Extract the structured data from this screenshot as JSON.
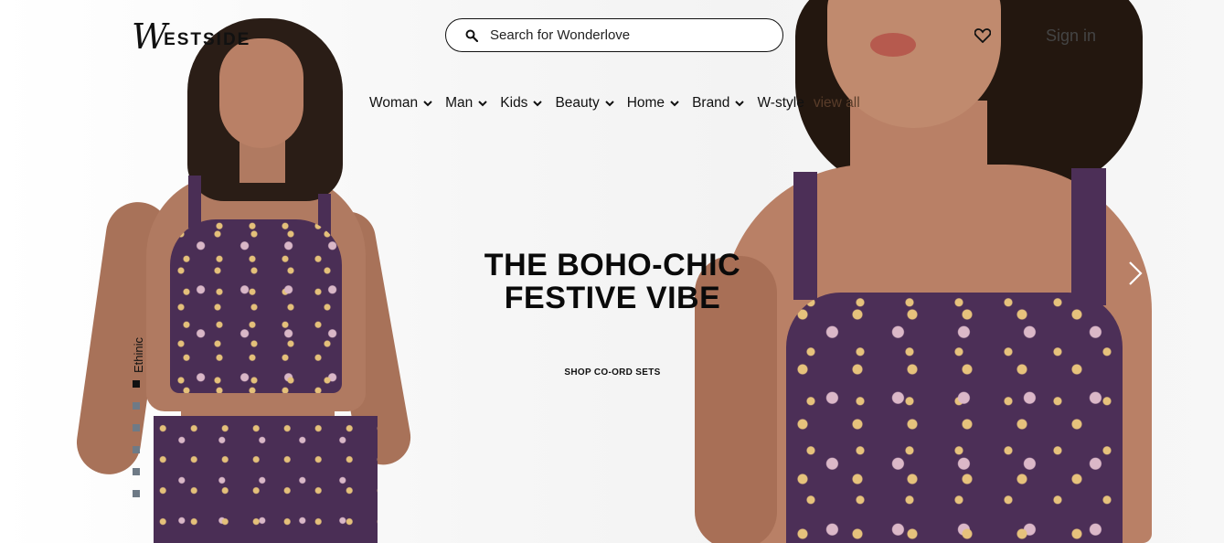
{
  "header": {
    "logo": {
      "initial": "W",
      "rest": "ESTSIDE"
    },
    "search": {
      "placeholder": "Search for Wonderlove",
      "value": ""
    },
    "wishlist_icon": "heart-icon",
    "signin_label": "Sign in"
  },
  "nav": {
    "items": [
      {
        "label": "Woman"
      },
      {
        "label": "Man"
      },
      {
        "label": "Kids"
      },
      {
        "label": "Beauty"
      },
      {
        "label": "Home"
      },
      {
        "label": "Brand"
      }
    ],
    "wstyle_label": "W-style",
    "more_label": "view all"
  },
  "hero": {
    "title_line1": "THE BOHO-CHIC",
    "title_line2": "FESTIVE VIBE",
    "cta_label": "SHOP CO-ORD SETS",
    "side_label": "Ethinic",
    "slide_count": 6,
    "active_slide": 1,
    "next_icon": "chevron-right-icon"
  },
  "colors": {
    "accent": "#111111",
    "dot_inactive": "#6e7a86",
    "outfit": "#4a2e55"
  }
}
